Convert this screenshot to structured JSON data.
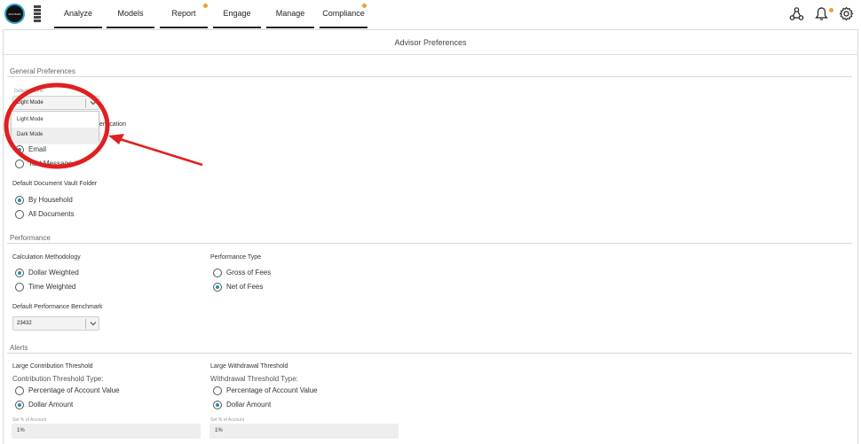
{
  "nav": {
    "logo_text": "ADVISOR",
    "items": [
      {
        "label": "Analyze"
      },
      {
        "label": "Models"
      },
      {
        "label": "Report"
      },
      {
        "label": "Engage"
      },
      {
        "label": "Manage"
      },
      {
        "label": "Compliance"
      }
    ],
    "accent_color": "#f0a030"
  },
  "page": {
    "title": "Advisor Preferences"
  },
  "general": {
    "section_title": "General Preferences",
    "theme": {
      "label": "Default Theme",
      "selected": "Light Mode",
      "options": [
        "Light Mode",
        "Dark Mode"
      ]
    },
    "authentication": {
      "label_partial": "entication",
      "options": [
        "Email",
        "Text Message"
      ],
      "selected": "Email"
    },
    "vault": {
      "label": "Default Document Vault Folder",
      "options": [
        "By Household",
        "All Documents"
      ],
      "selected": "By Household"
    }
  },
  "performance": {
    "section_title": "Performance",
    "calc": {
      "label": "Calculation Methodology",
      "options": [
        "Dollar Weighted",
        "Time Weighted"
      ],
      "selected": "Dollar Weighted"
    },
    "type": {
      "label": "Performance Type",
      "options": [
        "Gross of Fees",
        "Net of Fees"
      ],
      "selected": "Net of Fees"
    },
    "benchmark": {
      "label": "Default Performance Benchmark",
      "value": "23432"
    }
  },
  "alerts": {
    "section_title": "Alerts",
    "contribution": {
      "label": "Large Contribution Threshold",
      "type_label": "Contribution Threshold Type:",
      "options": [
        "Percentage of Account Value",
        "Dollar Amount"
      ],
      "selected": "Dollar Amount",
      "set_label": "Set % of Account",
      "value": "1%"
    },
    "withdrawal": {
      "label": "Large Withdrawal Threshold",
      "type_label": "Withdrawal Threshold Type:",
      "options": [
        "Percentage of Account Value",
        "Dollar Amount"
      ],
      "selected": "Dollar Amount",
      "set_label": "Set % of Account",
      "value": "1%"
    }
  },
  "annotation": {
    "color": "#e02020"
  }
}
